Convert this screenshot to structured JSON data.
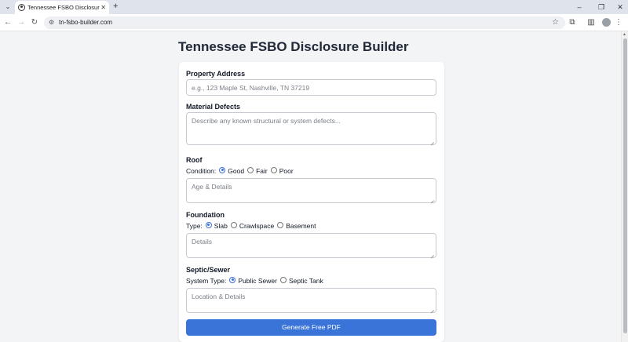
{
  "browser": {
    "tab_title": "Tennessee FSBO Disclosure Builder",
    "url": "tn-fsbo-builder.com"
  },
  "page": {
    "title": "Tennessee FSBO Disclosure Builder"
  },
  "form": {
    "property_address": {
      "label": "Property Address",
      "placeholder": "e.g., 123 Maple St, Nashville, TN 37219",
      "value": ""
    },
    "material_defects": {
      "label": "Material Defects",
      "placeholder": "Describe any known structural or system defects...",
      "value": ""
    },
    "roof": {
      "label": "Roof",
      "prompt": "Condition:",
      "options": [
        "Good",
        "Fair",
        "Poor"
      ],
      "selected": "Good",
      "details_placeholder": "Age & Details"
    },
    "foundation": {
      "label": "Foundation",
      "prompt": "Type:",
      "options": [
        "Slab",
        "Crawlspace",
        "Basement"
      ],
      "selected": "Slab",
      "details_placeholder": "Details"
    },
    "septic": {
      "label": "Septic/Sewer",
      "prompt": "System Type:",
      "options": [
        "Public Sewer",
        "Septic Tank"
      ],
      "selected": "Public Sewer",
      "details_placeholder": "Location & Details"
    },
    "submit_label": "Generate Free PDF"
  },
  "icons": {
    "tab_menu": "chevron-down-icon",
    "favicon": "globe-icon",
    "close": "close-icon",
    "new_tab": "plus-icon",
    "back": "arrow-left-icon",
    "forward": "arrow-right-icon",
    "reload": "reload-icon",
    "site_info": "tune-icon",
    "bookmark": "star-icon",
    "extensions": "puzzle-icon",
    "side_panel": "side-panel-icon",
    "profile": "avatar-icon",
    "menu": "kebab-menu-icon"
  },
  "colors": {
    "accent": "#3b74d9",
    "page_background": "#f3f4f6",
    "card_background": "#ffffff"
  }
}
